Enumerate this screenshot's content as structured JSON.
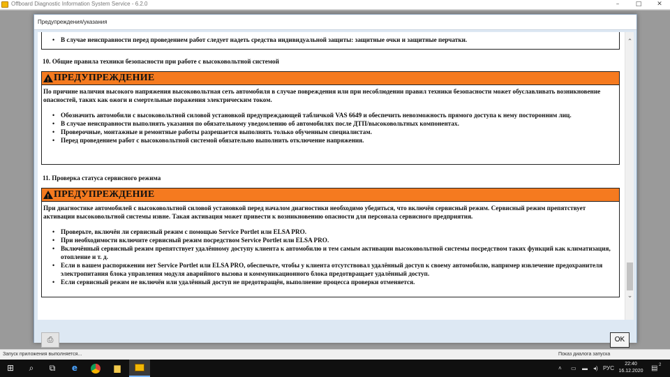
{
  "window": {
    "title": "Offboard Diagnostic Information System Service - 6.2.0",
    "minimize": "–",
    "maximize": "□",
    "close": "✕"
  },
  "dialog": {
    "title": "Предупреждения/указания",
    "ok_label": "OK"
  },
  "content": {
    "top_cut_item": "В случае неисправности перед проведением работ следует надеть средства индивидуальной защиты: защитные очки и защитные перчатки.",
    "sections": [
      {
        "heading": "10. Общие правила техники безопасности при работе с высоковольтной системой",
        "warning_label": "ПРЕДУПРЕЖДЕНИЕ",
        "intro": "По причине наличия высокого напряжения высоковольтная сеть автомобиля в случае повреждения или при несоблюдении правил техники безопасности может обуславливать возникновение опасностей, таких как ожоги и смертельные поражения электрическим током.",
        "items": [
          "Обозначить автомобили с высоковольтной силовой установкой предупреждающей табличкой VAS 6649 и обеспечить невозможность прямого доступа к нему посторонним лиц.",
          "В случае неисправности выполнять указания по обязательному уведомлению об автомобилях после ДТП/высоковольтных компонентах.",
          "Проверочные, монтажные и ремонтные работы разрешается выполнять только обученным специалистам.",
          "Перед проведением работ с высоковольтной системой обязательно выполнить отключение напряжения."
        ]
      },
      {
        "heading": "11. Проверка статуса сервисного режима",
        "warning_label": "ПРЕДУПРЕЖДЕНИЕ",
        "intro": "При диагностике автомобилей с высоковольтной силовой установкой перед началом диагностики необходимо убедиться, что включён сервисный режим. Сервисный режим препятствует активации высоковольтной системы извне. Такая активация может привести к возникновению опасности для персонала сервисного предприятия.",
        "items": [
          "Проверьте, включён ли сервисный режим с помощью Service Portlet или ELSA PRO.",
          "При необходимости включите сервисный режим посредством Service Portlet или ELSA PRO.",
          "Включённый сервисный режим препятствует удалённому доступу клиента к автомобилю и тем самым активации высоковольтной системы посредством таких функций как климатизация, отопление и т. д.",
          "Если в вашем распоряжении нет Service Portlet или ELSA PRO, обеспечьте, чтобы у клиента отсутствовал удалённый доступ к своему автомобилю, например извлечение предохранителя электропитания блока управления модуля аварийного вызова и коммуникационного блока предотвращает удалённый доступ.",
          "Если сервисный режим не включён или удалённый доступ не предотвращён, выполнение процесса проверки отменяется."
        ]
      }
    ]
  },
  "status_bar": {
    "left": "Запуск приложения выполняется...",
    "right": "Показ диалога запуска"
  },
  "taskbar": {
    "language": "РУС",
    "time": "22:40",
    "date": "16.12.2020",
    "notification_count": "2"
  },
  "colors": {
    "warning_bar": "#f57a1f",
    "dialog_bg": "#dde8f3"
  }
}
